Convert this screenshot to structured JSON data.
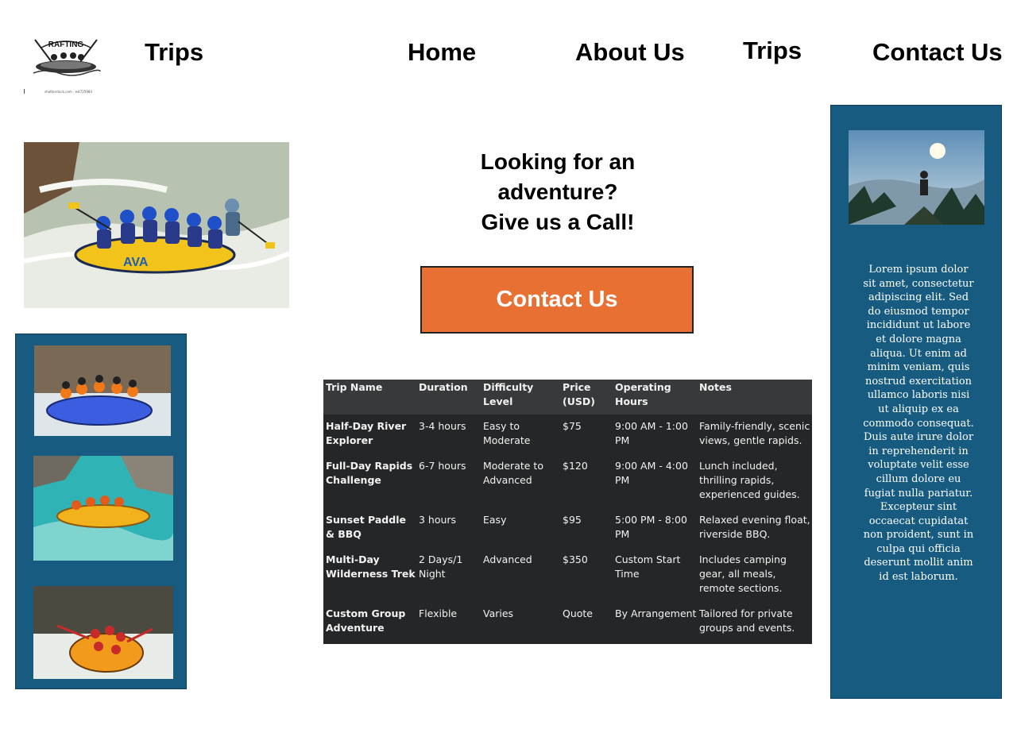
{
  "header": {
    "brand_title": "Trips",
    "logo_text": "RAFTING",
    "logo_caption": "shutterstock.com · est725984",
    "nav": [
      {
        "label": "Home"
      },
      {
        "label": "About Us"
      },
      {
        "label": "Trips"
      },
      {
        "label": "Contact Us"
      }
    ]
  },
  "hero": {
    "tagline_lines": [
      "Looking for an",
      "adventure?",
      "Give us a Call!"
    ],
    "raft_label": "AVA"
  },
  "cta": {
    "label": "Contact Us"
  },
  "trips_table": {
    "columns": [
      "Trip Name",
      "Duration",
      "Difficulty Level",
      "Price (USD)",
      "Operating Hours",
      "Notes"
    ],
    "rows": [
      [
        "Half-Day River Explorer",
        "3-4 hours",
        "Easy to Moderate",
        "$75",
        "9:00 AM - 1:00 PM",
        "Family-friendly, scenic views, gentle rapids."
      ],
      [
        "Full-Day Rapids Challenge",
        "6-7 hours",
        "Moderate to Advanced",
        "$120",
        "9:00 AM - 4:00 PM",
        "Lunch included, thrilling rapids, experienced guides."
      ],
      [
        "Sunset Paddle & BBQ",
        "3 hours",
        "Easy",
        "$95",
        "5:00 PM - 8:00 PM",
        "Relaxed evening float, riverside BBQ."
      ],
      [
        "Multi-Day Wilderness Trek",
        "2 Days/1 Night",
        "Advanced",
        "$350",
        "Custom Start Time",
        "Includes camping gear, all meals, remote sections."
      ],
      [
        "Custom Group Adventure",
        "Flexible",
        "Varies",
        "Quote",
        "By Arrangement",
        "Tailored for private groups and events."
      ]
    ]
  },
  "sidebar_text": "Lorem ipsum dolor sit amet, consectetur adipiscing elit. Sed do eiusmod tempor incididunt ut labore et dolore magna aliqua. Ut enim ad minim veniam, quis nostrud exercitation ullamco laboris nisi ut aliquip ex ea commodo consequat. Duis aute irure dolor in reprehenderit in voluptate velit esse cillum dolore eu fugiat nulla pariatur. Excepteur sint occaecat cupidatat non proident, sunt in culpa qui officia deserunt mollit anim id est laborum.",
  "colors": {
    "panel_blue": "#175c80",
    "cta_orange": "#e87033",
    "table_bg": "#252628",
    "table_header_bg": "#38393b"
  }
}
